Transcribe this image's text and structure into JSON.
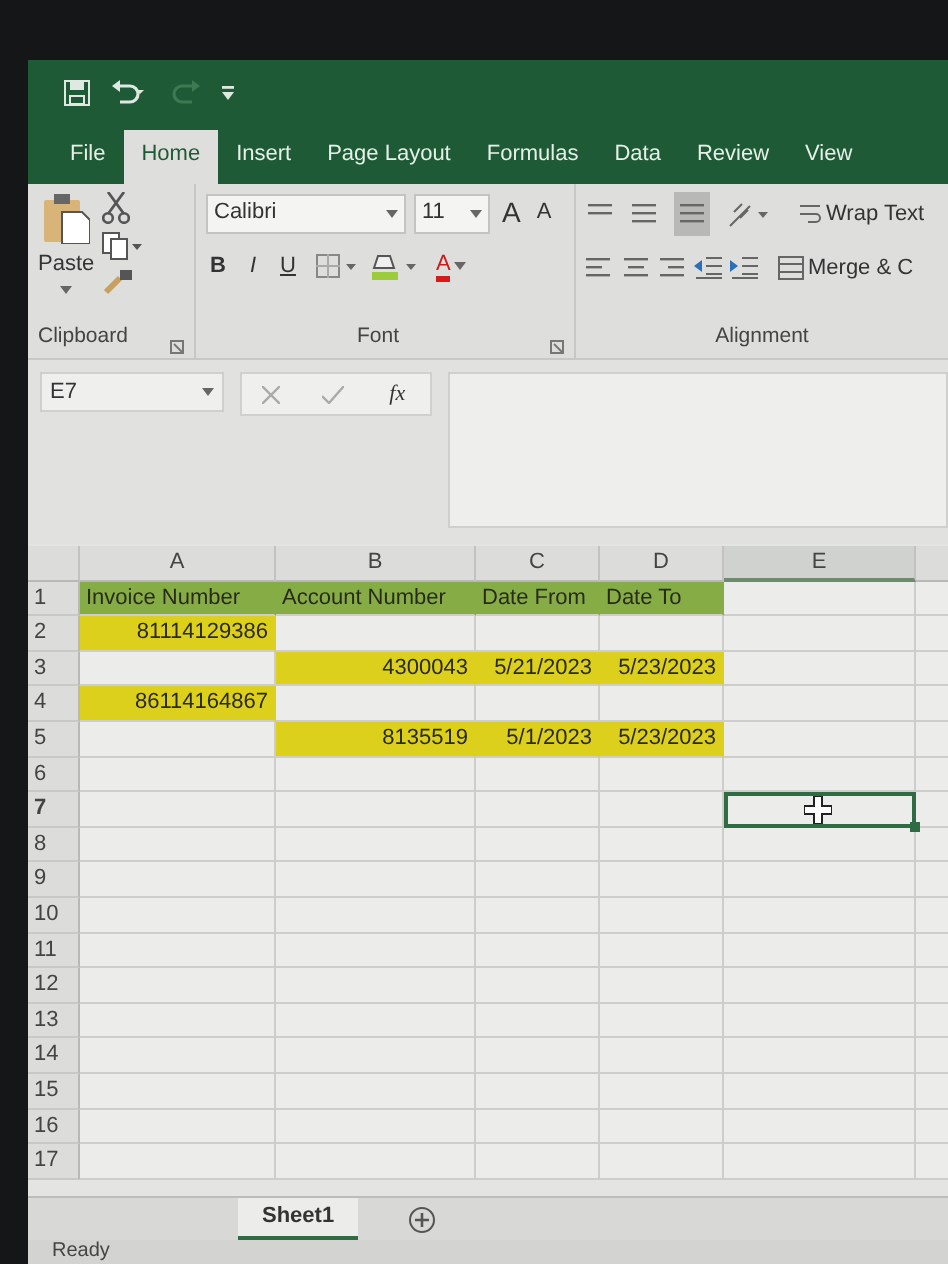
{
  "quick_access": {
    "redo_disabled": true
  },
  "tabs": [
    {
      "label": "File",
      "selected": false
    },
    {
      "label": "Home",
      "selected": true
    },
    {
      "label": "Insert",
      "selected": false
    },
    {
      "label": "Page Layout",
      "selected": false
    },
    {
      "label": "Formulas",
      "selected": false
    },
    {
      "label": "Data",
      "selected": false
    },
    {
      "label": "Review",
      "selected": false
    },
    {
      "label": "View",
      "selected": false
    }
  ],
  "ribbon": {
    "clipboard": {
      "paste": "Paste",
      "label": "Clipboard"
    },
    "font": {
      "name": "Calibri",
      "size": "11",
      "grow": "A",
      "shrink": "A",
      "bold": "B",
      "italic": "I",
      "underline": "U",
      "fill_glyph": "A",
      "label": "Font"
    },
    "alignment": {
      "bottom_align_selected": true,
      "wrap_text": "Wrap Text",
      "merge": "Merge & C",
      "label": "Alignment"
    }
  },
  "formula_bar": {
    "name_box": "E7",
    "fx": "fx"
  },
  "columns": [
    "A",
    "B",
    "C",
    "D",
    "E"
  ],
  "rows": [
    {
      "header": "1",
      "cells": [
        {
          "text": "Invoice Number",
          "color": "#86ad45",
          "selected": false
        },
        {
          "text": "Account Number",
          "color": "#86ad45",
          "selected": false
        },
        {
          "text": "Date From",
          "color": "#86ad45",
          "selected": false
        },
        {
          "text": "Date To",
          "color": "#86ad45",
          "selected": false
        },
        {
          "text": "",
          "selected": false
        }
      ]
    },
    {
      "header": "2",
      "cells": [
        {
          "text": "81114129386",
          "color": "#ddd01c",
          "selected": false
        },
        {
          "text": "",
          "selected": false
        },
        {
          "text": "",
          "selected": false
        },
        {
          "text": "",
          "selected": false
        },
        {
          "text": "",
          "selected": false
        }
      ]
    },
    {
      "header": "3",
      "cells": [
        {
          "text": "",
          "selected": false
        },
        {
          "text": "4300043",
          "color": "#ddd01c",
          "selected": false
        },
        {
          "text": "5/21/2023",
          "color": "#ddd01c",
          "selected": false
        },
        {
          "text": "5/23/2023",
          "color": "#ddd01c",
          "selected": false
        },
        {
          "text": "",
          "selected": false
        }
      ]
    },
    {
      "header": "4",
      "cells": [
        {
          "text": "86114164867",
          "color": "#ddd01c",
          "selected": false
        },
        {
          "text": "",
          "selected": false
        },
        {
          "text": "",
          "selected": false
        },
        {
          "text": "",
          "selected": false
        },
        {
          "text": "",
          "selected": false
        }
      ]
    },
    {
      "header": "5",
      "cells": [
        {
          "text": "",
          "selected": false
        },
        {
          "text": "8135519",
          "color": "#ddd01c",
          "selected": false
        },
        {
          "text": "5/1/2023",
          "color": "#ddd01c",
          "selected": false
        },
        {
          "text": "5/23/2023",
          "color": "#ddd01c",
          "selected": false
        },
        {
          "text": "",
          "selected": false
        }
      ]
    },
    {
      "header": "6",
      "cells": [
        {
          "text": "",
          "selected": false
        },
        {
          "text": "",
          "selected": false
        },
        {
          "text": "",
          "selected": false
        },
        {
          "text": "",
          "selected": false
        },
        {
          "text": "",
          "selected": false
        }
      ]
    },
    {
      "header": "7",
      "cells": [
        {
          "text": "",
          "selected": false
        },
        {
          "text": "",
          "selected": false
        },
        {
          "text": "",
          "selected": false
        },
        {
          "text": "",
          "selected": false
        },
        {
          "text": "",
          "selected": true
        }
      ]
    },
    {
      "header": "8",
      "cells": [
        {
          "text": "",
          "selected": false
        },
        {
          "text": "",
          "selected": false
        },
        {
          "text": "",
          "selected": false
        },
        {
          "text": "",
          "selected": false
        },
        {
          "text": "",
          "selected": false
        }
      ]
    },
    {
      "header": "9",
      "cells": [
        {
          "text": "",
          "selected": false
        },
        {
          "text": "",
          "selected": false
        },
        {
          "text": "",
          "selected": false
        },
        {
          "text": "",
          "selected": false
        },
        {
          "text": "",
          "selected": false
        }
      ]
    },
    {
      "header": "10",
      "cells": [
        {
          "text": "",
          "selected": false
        },
        {
          "text": "",
          "selected": false
        },
        {
          "text": "",
          "selected": false
        },
        {
          "text": "",
          "selected": false
        },
        {
          "text": "",
          "selected": false
        }
      ]
    },
    {
      "header": "11",
      "cells": [
        {
          "text": "",
          "selected": false
        },
        {
          "text": "",
          "selected": false
        },
        {
          "text": "",
          "selected": false
        },
        {
          "text": "",
          "selected": false
        },
        {
          "text": "",
          "selected": false
        }
      ]
    },
    {
      "header": "12",
      "cells": [
        {
          "text": "",
          "selected": false
        },
        {
          "text": "",
          "selected": false
        },
        {
          "text": "",
          "selected": false
        },
        {
          "text": "",
          "selected": false
        },
        {
          "text": "",
          "selected": false
        }
      ]
    },
    {
      "header": "13",
      "cells": [
        {
          "text": "",
          "selected": false
        },
        {
          "text": "",
          "selected": false
        },
        {
          "text": "",
          "selected": false
        },
        {
          "text": "",
          "selected": false
        },
        {
          "text": "",
          "selected": false
        }
      ]
    },
    {
      "header": "14",
      "cells": [
        {
          "text": "",
          "selected": false
        },
        {
          "text": "",
          "selected": false
        },
        {
          "text": "",
          "selected": false
        },
        {
          "text": "",
          "selected": false
        },
        {
          "text": "",
          "selected": false
        }
      ]
    },
    {
      "header": "15",
      "cells": [
        {
          "text": "",
          "selected": false
        },
        {
          "text": "",
          "selected": false
        },
        {
          "text": "",
          "selected": false
        },
        {
          "text": "",
          "selected": false
        },
        {
          "text": "",
          "selected": false
        }
      ]
    },
    {
      "header": "16",
      "cells": [
        {
          "text": "",
          "selected": false
        },
        {
          "text": "",
          "selected": false
        },
        {
          "text": "",
          "selected": false
        },
        {
          "text": "",
          "selected": false
        },
        {
          "text": "",
          "selected": false
        }
      ]
    },
    {
      "header": "17",
      "cells": [
        {
          "text": "",
          "selected": false
        },
        {
          "text": "",
          "selected": false
        },
        {
          "text": "",
          "selected": false
        },
        {
          "text": "",
          "selected": false
        },
        {
          "text": "",
          "selected": false
        }
      ]
    }
  ],
  "sheet_tabs": [
    {
      "label": "Sheet1",
      "selected": true
    }
  ],
  "status_bar": {
    "text": "Ready"
  }
}
